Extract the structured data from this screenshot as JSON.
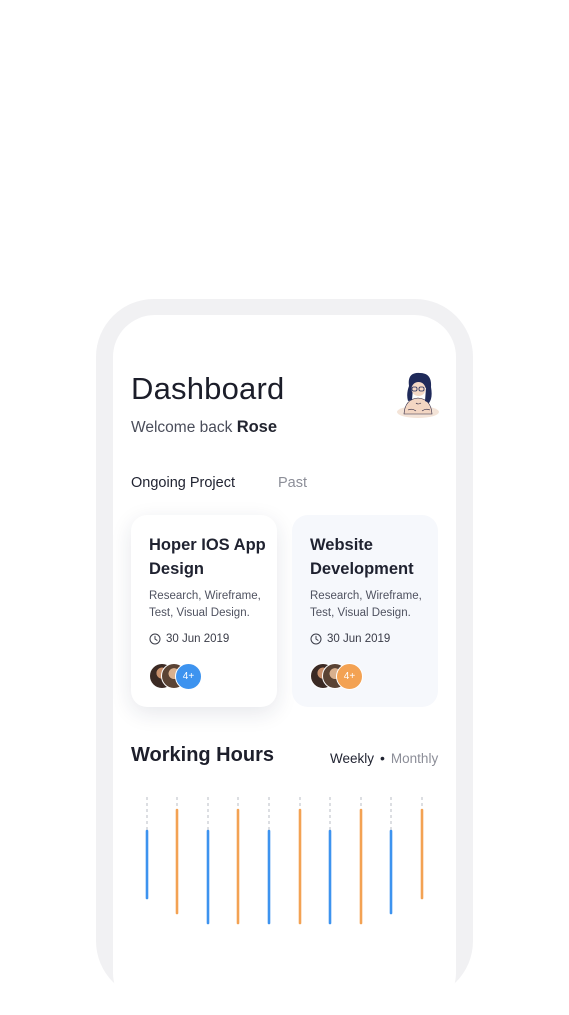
{
  "header": {
    "title": "Dashboard",
    "welcome_text": "Welcome back",
    "user_name": "Rose"
  },
  "tabs": [
    {
      "label": "Ongoing Project",
      "active": true
    },
    {
      "label": "Past",
      "active": false
    }
  ],
  "projects": [
    {
      "title": "Hoper IOS App Design",
      "tags": "Research, Wireframe, Test, Visual Design.",
      "date": "30 Jun 2019",
      "extra_members": "4+",
      "accent": "#3d93ef"
    },
    {
      "title": "Website Development",
      "tags": "Research, Wireframe, Test, Visual Design.",
      "date": "30 Jun 2019",
      "extra_members": "4+",
      "accent": "#f3a253"
    }
  ],
  "working_hours": {
    "title": "Working Hours",
    "options": [
      "Weekly",
      "Monthly"
    ],
    "selected": "Weekly"
  },
  "colors": {
    "blue": "#3d93ef",
    "orange": "#f3a253",
    "frame": "#f1f1f3"
  },
  "icons": {
    "clock": "clock-icon",
    "avatar": "user-avatar-illustration"
  }
}
